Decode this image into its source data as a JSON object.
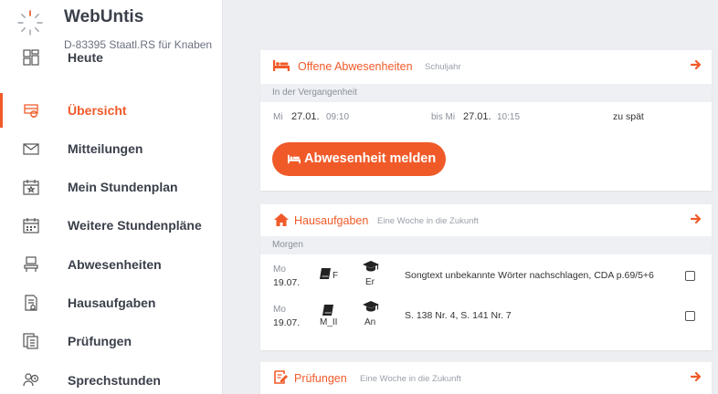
{
  "brand": {
    "title": "WebUntis",
    "school": "D-83395 Staatl.RS für Knaben"
  },
  "sidebar": {
    "items": [
      {
        "label": "Heute",
        "icon": "dashboard-icon",
        "active": false
      },
      {
        "label": "Übersicht",
        "icon": "overview-icon",
        "active": true
      },
      {
        "label": "Mitteilungen",
        "icon": "envelope-icon",
        "active": false
      },
      {
        "label": "Mein Stundenplan",
        "icon": "calendar-star-icon",
        "active": false
      },
      {
        "label": "Weitere Stundenpläne",
        "icon": "calendar-grid-icon",
        "active": false
      },
      {
        "label": "Abwesenheiten",
        "icon": "absence-icon",
        "active": false
      },
      {
        "label": "Hausaufgaben",
        "icon": "homework-icon",
        "active": false
      },
      {
        "label": "Prüfungen",
        "icon": "exams-icon",
        "active": false
      },
      {
        "label": "Sprechstunden",
        "icon": "consultation-icon",
        "active": false
      }
    ]
  },
  "absences": {
    "title": "Offene Abwesenheiten",
    "subtitle": "Schuljahr",
    "section": "In der Vergangenheit",
    "row": {
      "from_day": "Mi",
      "from_date": "27.01.",
      "from_time": "09:10",
      "to_prefix": "bis Mi",
      "to_date": "27.01.",
      "to_time": "10:15",
      "status": "zu spät"
    },
    "button_label": "Abwesenheit melden"
  },
  "homework": {
    "title": "Hausaufgaben",
    "subtitle": "Eine Woche in die Zukunft",
    "section": "Morgen",
    "rows": [
      {
        "day": "Mo",
        "date": "19.07.",
        "subject": "F",
        "teacher": "Er",
        "text": "Songtext unbekannte Wörter nachschlagen, CDA p.69/5+6"
      },
      {
        "day": "Mo",
        "date": "19.07.",
        "subject": "M_II",
        "teacher": "An",
        "text": "S. 138 Nr. 4, S. 141 Nr. 7"
      }
    ]
  },
  "exams": {
    "title": "Prüfungen",
    "subtitle": "Eine Woche in die Zukunft"
  },
  "colors": {
    "accent": "#f05a28",
    "background": "#eceef1",
    "sidebar": "#ffffff"
  }
}
